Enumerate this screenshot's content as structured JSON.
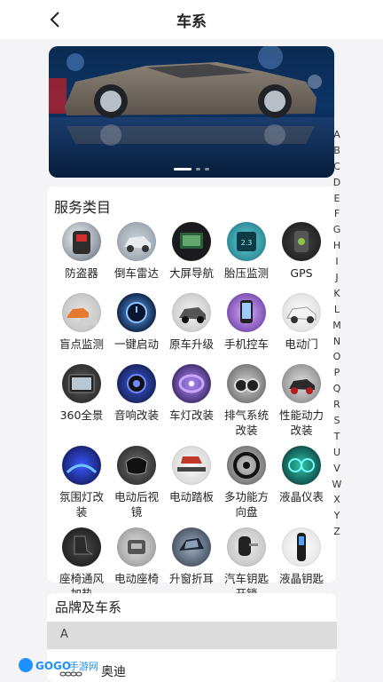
{
  "header": {
    "title": "车系"
  },
  "banner": {
    "slides": 3,
    "active_index": 0
  },
  "services": {
    "title": "服务类目",
    "items": [
      {
        "label": "防盗器",
        "icon": "car-alarm-icon"
      },
      {
        "label": "倒车雷达",
        "icon": "parking-radar-icon"
      },
      {
        "label": "大屏导航",
        "icon": "navigation-screen-icon"
      },
      {
        "label": "胎压监测",
        "icon": "tire-pressure-icon"
      },
      {
        "label": "GPS",
        "icon": "gps-tracker-icon"
      },
      {
        "label": "盲点监测",
        "icon": "blind-spot-icon"
      },
      {
        "label": "一键启动",
        "icon": "start-button-icon"
      },
      {
        "label": "原车升级",
        "icon": "car-upgrade-icon"
      },
      {
        "label": "手机控车",
        "icon": "phone-control-icon"
      },
      {
        "label": "电动门",
        "icon": "electric-door-icon"
      },
      {
        "label": "360全景",
        "icon": "panorama-360-icon"
      },
      {
        "label": "音响改装",
        "icon": "audio-modification-icon"
      },
      {
        "label": "车灯改装",
        "icon": "headlight-modification-icon"
      },
      {
        "label": "排气系统改装",
        "icon": "exhaust-system-icon"
      },
      {
        "label": "性能动力改装",
        "icon": "performance-tuning-icon"
      },
      {
        "label": "氛围灯改装",
        "icon": "ambient-light-icon"
      },
      {
        "label": "电动后视镜",
        "icon": "electric-mirror-icon"
      },
      {
        "label": "电动踏板",
        "icon": "electric-step-icon"
      },
      {
        "label": "多功能方向盘",
        "icon": "steering-wheel-icon"
      },
      {
        "label": "液晶仪表",
        "icon": "lcd-dashboard-icon"
      },
      {
        "label": "座椅通风加热",
        "icon": "seat-ventilation-icon"
      },
      {
        "label": "电动座椅",
        "icon": "electric-seat-icon"
      },
      {
        "label": "升窗折耳",
        "icon": "window-fold-icon"
      },
      {
        "label": "汽车钥匙开锁",
        "icon": "car-key-unlock-icon"
      },
      {
        "label": "液晶钥匙",
        "icon": "lcd-key-icon"
      }
    ]
  },
  "brands": {
    "title": "品牌及车系",
    "section_letter": "A",
    "first_brand": "奥迪"
  },
  "index_letters": [
    "A",
    "B",
    "C",
    "D",
    "E",
    "F",
    "G",
    "H",
    "I",
    "J",
    "K",
    "L",
    "M",
    "N",
    "O",
    "P",
    "Q",
    "R",
    "S",
    "T",
    "U",
    "V",
    "W",
    "X",
    "Y",
    "Z"
  ],
  "watermark": {
    "text": "GOGO手游网",
    "logo_text": "GOGO"
  },
  "colors": {
    "accent": "#1e90ff",
    "divider": "#dcdcdc"
  }
}
